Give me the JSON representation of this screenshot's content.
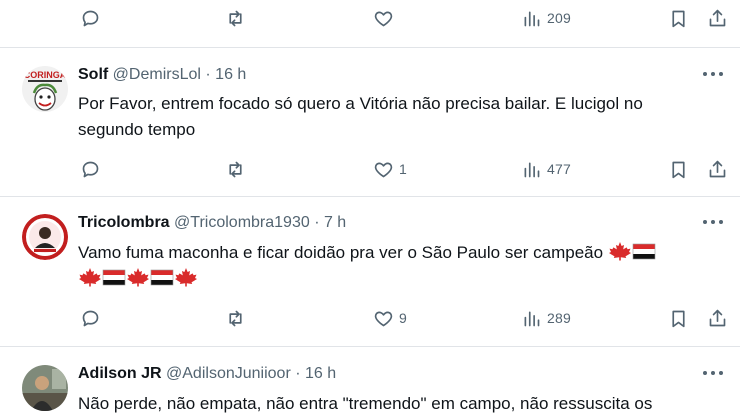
{
  "colors": {
    "icon": "#536471",
    "text": "#0f1419",
    "divider": "#e1e4e8",
    "red": "#d92b2b",
    "black": "#111111"
  },
  "top_actions": {
    "views": "209"
  },
  "tweets": [
    {
      "name": "Solf",
      "handle": "@DemirsLol",
      "time": "· 16 h",
      "avatar_text": "CORINGA",
      "text_line1": "Por Favor, entrem focado só quero a Vitória não precisa bailar. E lucigol no",
      "text_line2": "segundo tempo",
      "likes": "1",
      "views": "477"
    },
    {
      "name": "Tricolombra",
      "handle": "@Tricolombra1930",
      "time": "· 7 h",
      "text_line1": "Vamo fuma maconha e ficar doidão pra ver o São Paulo ser campeão",
      "emoji_line1": [
        "maple-leaf",
        "spfc-flag"
      ],
      "emoji_line2": [
        "maple-leaf",
        "spfc-flag",
        "maple-leaf",
        "spfc-flag",
        "maple-leaf"
      ],
      "likes": "9",
      "views": "289"
    },
    {
      "name": "Adilson JR",
      "handle": "@AdilsonJuniioor",
      "time": "· 16 h",
      "text_line1": "Não perde, não empata, não entra \"tremendo\" em campo, não ressuscita os"
    }
  ]
}
